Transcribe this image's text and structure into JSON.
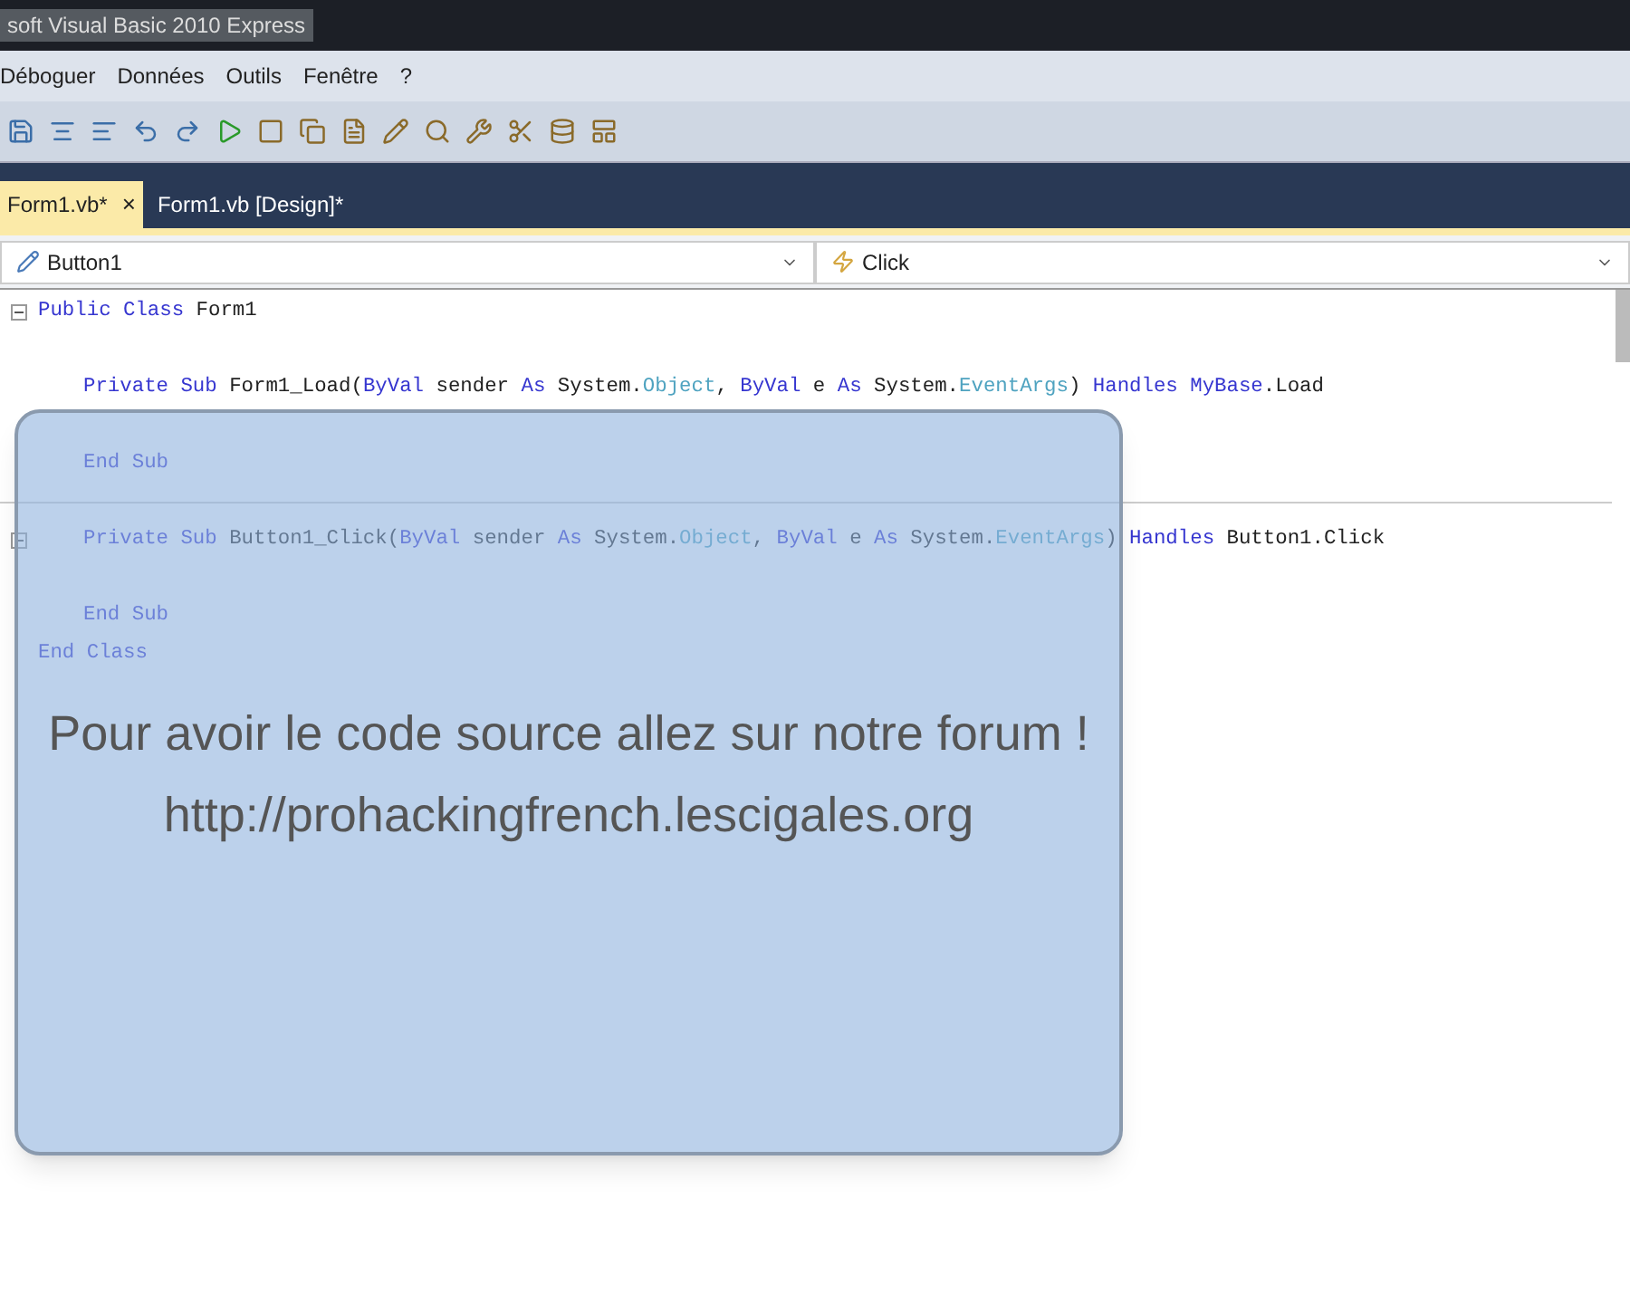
{
  "window": {
    "title": "soft Visual Basic 2010 Express"
  },
  "menu": [
    "Déboguer",
    "Données",
    "Outils",
    "Fenêtre",
    "?"
  ],
  "tabs": [
    {
      "label": "Form1.vb*",
      "selected": true,
      "close": "×"
    },
    {
      "label": "Form1.vb [Design]*",
      "selected": false
    }
  ],
  "selectors": [
    {
      "kind": "object",
      "value": "Button1"
    },
    {
      "kind": "event",
      "value": "Click"
    }
  ],
  "code": [
    {
      "kind": "code",
      "fold": true,
      "tokens": [
        {
          "text": "Public Class ",
          "kind": "keyword"
        },
        {
          "text": "Form1",
          "kind": "plain"
        }
      ],
      "children": [
        {
          "kind": "blank"
        },
        {
          "kind": "code",
          "fold": false,
          "tokens": [
            {
              "text": "Private Sub ",
              "kind": "keyword"
            },
            {
              "text": "Form1_Load(",
              "kind": "plain"
            },
            {
              "text": "ByVal ",
              "kind": "keyword"
            },
            {
              "text": "sender ",
              "kind": "plain"
            },
            {
              "text": "As ",
              "kind": "keyword"
            },
            {
              "text": "System.",
              "kind": "plain"
            },
            {
              "text": "Object",
              "kind": "type"
            },
            {
              "text": ", ",
              "kind": "plain"
            },
            {
              "text": "ByVal ",
              "kind": "keyword"
            },
            {
              "text": "e ",
              "kind": "plain"
            },
            {
              "text": "As ",
              "kind": "keyword"
            },
            {
              "text": "System.",
              "kind": "plain"
            },
            {
              "text": "EventArgs",
              "kind": "type"
            },
            {
              "text": ") ",
              "kind": "plain"
            },
            {
              "text": "Handles ",
              "kind": "keyword"
            },
            {
              "text": "MyBase",
              "kind": "keyword"
            },
            {
              "text": ".Load",
              "kind": "plain"
            }
          ]
        },
        {
          "kind": "blank"
        },
        {
          "kind": "code",
          "fold": false,
          "tokens": [
            {
              "text": "End Sub",
              "kind": "keyword"
            }
          ]
        },
        {
          "kind": "separator"
        },
        {
          "kind": "code",
          "fold": true,
          "tokens": [
            {
              "text": "Private Sub ",
              "kind": "keyword"
            },
            {
              "text": "Button1_Click(",
              "kind": "plain"
            },
            {
              "text": "ByVal ",
              "kind": "keyword"
            },
            {
              "text": "sender ",
              "kind": "plain"
            },
            {
              "text": "As ",
              "kind": "keyword"
            },
            {
              "text": "System.",
              "kind": "plain"
            },
            {
              "text": "Object",
              "kind": "type"
            },
            {
              "text": ", ",
              "kind": "plain"
            },
            {
              "text": "ByVal ",
              "kind": "keyword"
            },
            {
              "text": "e ",
              "kind": "plain"
            },
            {
              "text": "As ",
              "kind": "keyword"
            },
            {
              "text": "System.",
              "kind": "plain"
            },
            {
              "text": "EventArgs",
              "kind": "type"
            },
            {
              "text": ") ",
              "kind": "plain"
            },
            {
              "text": "Handles ",
              "kind": "keyword"
            },
            {
              "text": "Button1.Click",
              "kind": "plain"
            }
          ]
        },
        {
          "kind": "blank"
        },
        {
          "kind": "code",
          "fold": false,
          "tokens": [
            {
              "text": "End Sub",
              "kind": "keyword"
            }
          ]
        }
      ]
    },
    {
      "kind": "code",
      "fold": false,
      "tokens": [
        {
          "text": "End Class",
          "kind": "keyword"
        }
      ]
    }
  ],
  "overlay": {
    "lines": [
      "Pour avoir le code source allez sur notre forum !",
      "http://prohackingfrench.lescigales.org"
    ]
  }
}
